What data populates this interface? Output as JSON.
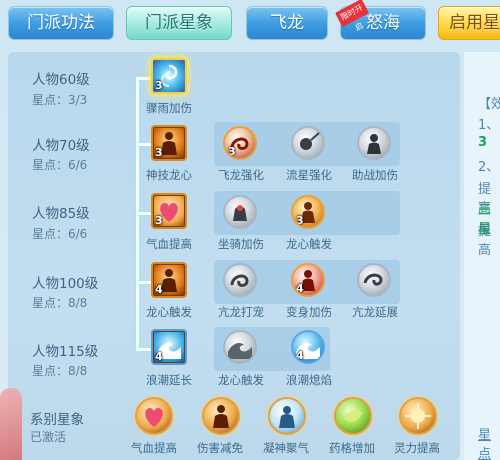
{
  "tabs": [
    {
      "label": "门派功法",
      "style": "blue"
    },
    {
      "label": "门派星象",
      "style": "active"
    },
    {
      "label": "飞龙",
      "style": "blue"
    },
    {
      "label": "怒海",
      "style": "blue",
      "badge": "限时开启"
    },
    {
      "label": "启用星",
      "style": "gold"
    }
  ],
  "rows": [
    {
      "level": "人物60级",
      "stars": "星点：3/3",
      "skills": [
        {
          "name": "骤雨加伤",
          "count": "3",
          "icon": "swirl-icon"
        }
      ]
    },
    {
      "level": "人物70级",
      "stars": "星点：6/6",
      "skills": [
        {
          "name": "神技龙心",
          "count": "3",
          "icon": "fighter-icon"
        },
        {
          "name": "飞龙强化",
          "count": "3",
          "icon": "dragon-icon"
        },
        {
          "name": "流星强化",
          "count": "",
          "icon": "meteor-icon"
        },
        {
          "name": "助战加伤",
          "count": "",
          "icon": "assist-icon"
        }
      ]
    },
    {
      "level": "人物85级",
      "stars": "星点：6/6",
      "skills": [
        {
          "name": "气血提高",
          "count": "3",
          "icon": "heart-icon"
        },
        {
          "name": "坐骑加伤",
          "count": "",
          "icon": "mount-icon"
        },
        {
          "name": "龙心触发",
          "count": "3",
          "icon": "fighter-orb-icon"
        }
      ]
    },
    {
      "level": "人物100级",
      "stars": "星点：8/8",
      "skills": [
        {
          "name": "龙心触发",
          "count": "4",
          "icon": "fighter-icon"
        },
        {
          "name": "亢龙打宠",
          "count": "",
          "icon": "dragon-strike-icon"
        },
        {
          "name": "变身加伤",
          "count": "4",
          "icon": "transform-icon"
        },
        {
          "name": "亢龙延展",
          "count": "",
          "icon": "dragon-extend-icon"
        }
      ]
    },
    {
      "level": "人物115级",
      "stars": "星点：8/8",
      "skills": [
        {
          "name": "浪潮延长",
          "count": "4",
          "icon": "wave-icon"
        },
        {
          "name": "龙心触发",
          "count": "",
          "icon": "wave-gray-icon"
        },
        {
          "name": "浪潮熄焰",
          "count": "4",
          "icon": "wave-orb-icon"
        }
      ]
    }
  ],
  "system": {
    "title": "系别星象",
    "status": "已激活",
    "items": [
      {
        "name": "气血提高",
        "icon": "heart-icon"
      },
      {
        "name": "伤害减免",
        "icon": "fighter-icon"
      },
      {
        "name": "凝神聚气",
        "icon": "focus-icon"
      },
      {
        "name": "药格增加",
        "icon": "potion-icon"
      },
      {
        "name": "灵力提高",
        "icon": "spirit-icon"
      }
    ]
  },
  "right": {
    "lines": [
      "【效",
      "1、",
      "3",
      "2、",
      "提高",
      "三星",
      "提高",
      "星点"
    ]
  }
}
